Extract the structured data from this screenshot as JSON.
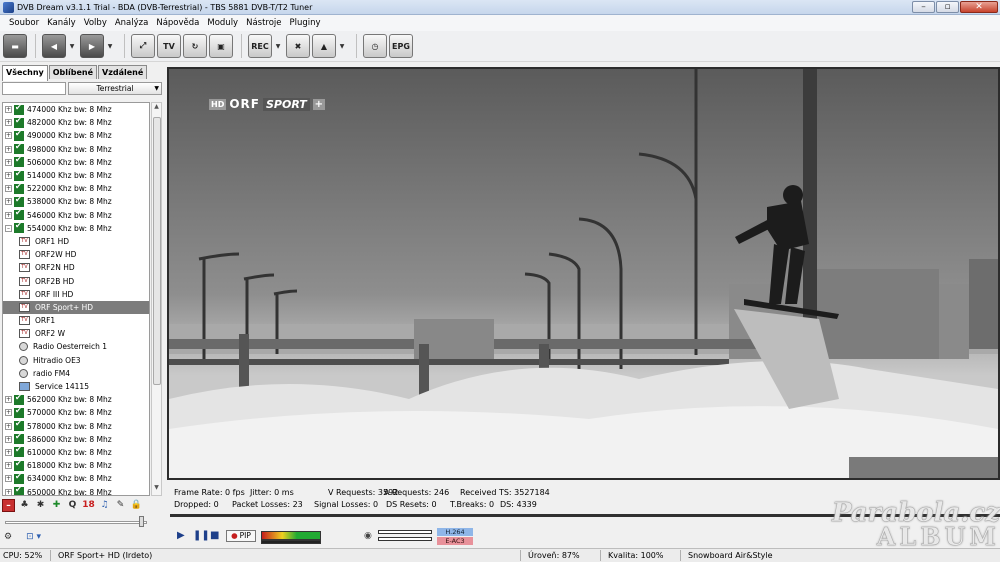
{
  "window": {
    "title": "DVB Dream v3.1.1 Trial - BDA (DVB-Terrestrial) - TBS 5881 DVB-T/T2 Tuner",
    "buttons": [
      "–",
      "▫",
      "✕"
    ]
  },
  "menu": [
    "Soubor",
    "Kanály",
    "Volby",
    "Analýza",
    "Nápověda",
    "Moduly",
    "Nástroje",
    "Pluginy"
  ],
  "toolbar": {
    "rec_label": "REC",
    "epg_label": "EPG",
    "tv_label": "TV"
  },
  "left_panel": {
    "tabs": [
      "Všechny",
      "Oblíbené",
      "Vzdálené"
    ],
    "source_select": "Terrestrial",
    "tree": [
      {
        "label": "474000 Khz  bw: 8 Mhz",
        "kind": "mux",
        "expander": "+"
      },
      {
        "label": "482000 Khz  bw: 8 Mhz",
        "kind": "mux",
        "expander": "+"
      },
      {
        "label": "490000 Khz  bw: 8 Mhz",
        "kind": "mux",
        "expander": "+"
      },
      {
        "label": "498000 Khz  bw: 8 Mhz",
        "kind": "mux",
        "expander": "+"
      },
      {
        "label": "506000 Khz  bw: 8 Mhz",
        "kind": "mux",
        "expander": "+"
      },
      {
        "label": "514000 Khz  bw: 8 Mhz",
        "kind": "mux",
        "expander": "+"
      },
      {
        "label": "522000 Khz  bw: 8 Mhz",
        "kind": "mux",
        "expander": "+"
      },
      {
        "label": "538000 Khz  bw: 8 Mhz",
        "kind": "mux",
        "expander": "+"
      },
      {
        "label": "546000 Khz  bw: 8 Mhz",
        "kind": "mux",
        "expander": "+"
      },
      {
        "label": "554000 Khz  bw: 8 Mhz",
        "kind": "mux",
        "expander": "–"
      },
      {
        "label": "ORF1 HD",
        "kind": "tv"
      },
      {
        "label": "ORF2W HD",
        "kind": "tv"
      },
      {
        "label": "ORF2N HD",
        "kind": "tv"
      },
      {
        "label": "ORF2B HD",
        "kind": "tv"
      },
      {
        "label": "ORF III HD",
        "kind": "tv"
      },
      {
        "label": "ORF Sport+ HD",
        "kind": "tv",
        "selected": true
      },
      {
        "label": "ORF1",
        "kind": "tv"
      },
      {
        "label": "ORF2 W",
        "kind": "tv"
      },
      {
        "label": "Radio Oesterreich 1",
        "kind": "radio"
      },
      {
        "label": "Hitradio OE3",
        "kind": "radio"
      },
      {
        "label": "radio FM4",
        "kind": "radio"
      },
      {
        "label": "Service 14115",
        "kind": "data"
      },
      {
        "label": "562000 Khz  bw: 8 Mhz",
        "kind": "mux",
        "expander": "+"
      },
      {
        "label": "570000 Khz  bw: 8 Mhz",
        "kind": "mux",
        "expander": "+"
      },
      {
        "label": "578000 Khz  bw: 8 Mhz",
        "kind": "mux",
        "expander": "+"
      },
      {
        "label": "586000 Khz  bw: 8 Mhz",
        "kind": "mux",
        "expander": "+"
      },
      {
        "label": "610000 Khz  bw: 8 Mhz",
        "kind": "mux",
        "expander": "+"
      },
      {
        "label": "618000 Khz  bw: 8 Mhz",
        "kind": "mux",
        "expander": "+"
      },
      {
        "label": "634000 Khz  bw: 8 Mhz",
        "kind": "mux",
        "expander": "+"
      },
      {
        "label": "650000 Khz  bw: 8 Mhz",
        "kind": "mux",
        "expander": "+"
      }
    ],
    "bottom_tools": [
      "–",
      "♣",
      "✱",
      "✚",
      "Q",
      "18",
      "♫",
      "✎",
      "🔒"
    ]
  },
  "video": {
    "osd_hd": "HD",
    "osd_orf": "ORF",
    "osd_sport": "SPORT",
    "osd_plus": "+"
  },
  "stats": {
    "frame_rate": "Frame Rate: 0 fps",
    "jitter": "Jitter: 0 ms",
    "v_requests": "V Requests: 3592",
    "a_requests": "A Requests: 246",
    "received_ts": "Received TS: 3527184",
    "dropped": "Dropped: 0",
    "packet_losses": "Packet Losses: 23",
    "signal_losses": "Signal Losses: 0",
    "ds_resets": "DS Resets: 0",
    "t_breaks": "T.Breaks: 0",
    "ds": "DS: 4339"
  },
  "playback": {
    "pip_label": "PIP",
    "video_codec": "H.264",
    "audio_codec": "E-AC3"
  },
  "watermark": {
    "line1": "Parabola.cz",
    "line2": "ALBUM"
  },
  "status": {
    "cpu": "CPU: 52%",
    "channel": "ORF Sport+ HD (Irdeto)",
    "level": "Úroveň: 87%",
    "quality": "Kvalita: 100%",
    "program": "Snowboard Air&Style"
  }
}
